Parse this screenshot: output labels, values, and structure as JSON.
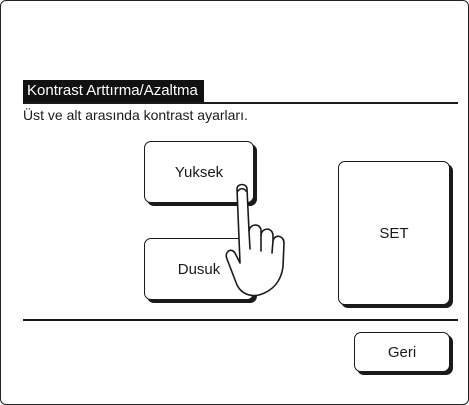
{
  "screen": {
    "title": "Kontrast Arttırma/Azaltma",
    "description": "Üst ve alt arasında kontrast ayarları."
  },
  "buttons": {
    "high_label": "Yuksek",
    "low_label": "Dusuk",
    "set_label": "SET",
    "back_label": "Geri"
  },
  "icons": {
    "pointer": "pointing-hand-icon"
  }
}
